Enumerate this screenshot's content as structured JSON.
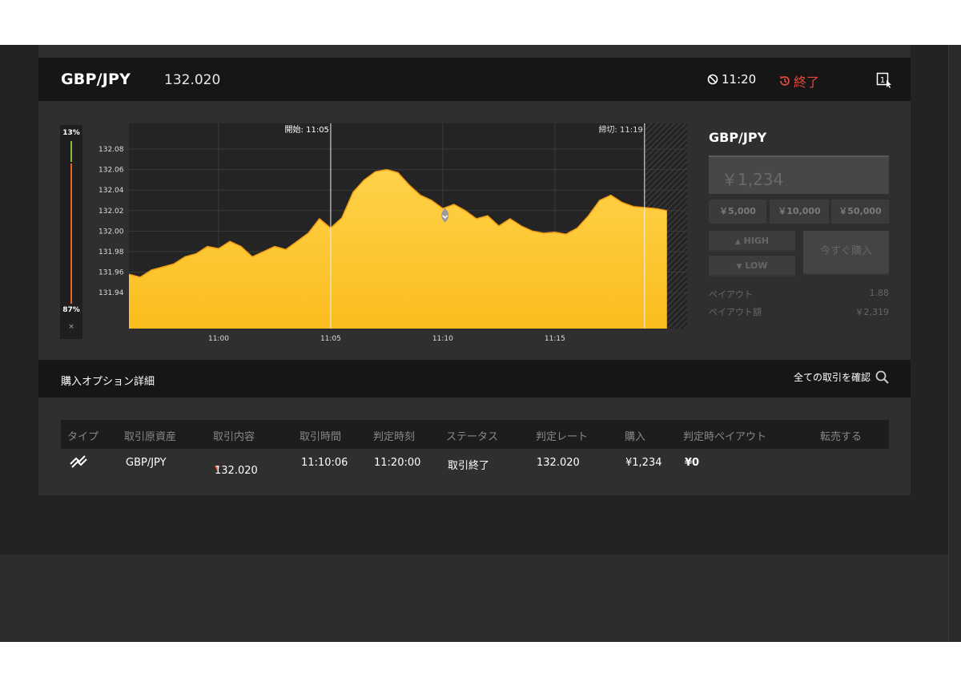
{
  "header": {
    "pair": "GBP/JPY",
    "price": "132.020",
    "timer": "11:20",
    "ended_label": "終了",
    "expand_label": "1"
  },
  "sentiment": {
    "top_pct": "13%",
    "bottom_pct": "87%",
    "close": "×"
  },
  "chart_data": {
    "type": "area",
    "y_ticks": [
      "132.08",
      "132.06",
      "132.04",
      "132.02",
      "132.00",
      "131.98",
      "131.96",
      "131.94"
    ],
    "x_ticks": [
      "11:00",
      "11:05",
      "11:10",
      "11:15"
    ],
    "ylim": [
      131.905,
      132.105
    ],
    "start_label": "開始: 11:05",
    "deadline_label": "締切: 11:19",
    "purchase": {
      "time": "11:10:06",
      "rate": 132.02
    },
    "series": [
      {
        "x": "10:56:00",
        "y": 131.958
      },
      {
        "x": "10:56:30",
        "y": 131.955
      },
      {
        "x": "10:57:00",
        "y": 131.962
      },
      {
        "x": "10:57:30",
        "y": 131.965
      },
      {
        "x": "10:58:00",
        "y": 131.968
      },
      {
        "x": "10:58:30",
        "y": 131.975
      },
      {
        "x": "10:59:00",
        "y": 131.978
      },
      {
        "x": "10:59:30",
        "y": 131.985
      },
      {
        "x": "11:00:00",
        "y": 131.983
      },
      {
        "x": "11:00:30",
        "y": 131.99
      },
      {
        "x": "11:01:00",
        "y": 131.985
      },
      {
        "x": "11:01:30",
        "y": 131.975
      },
      {
        "x": "11:02:00",
        "y": 131.98
      },
      {
        "x": "11:02:30",
        "y": 131.985
      },
      {
        "x": "11:03:00",
        "y": 131.982
      },
      {
        "x": "11:03:30",
        "y": 131.99
      },
      {
        "x": "11:04:00",
        "y": 131.998
      },
      {
        "x": "11:04:30",
        "y": 132.012
      },
      {
        "x": "11:05:00",
        "y": 132.003
      },
      {
        "x": "11:05:30",
        "y": 132.013
      },
      {
        "x": "11:06:00",
        "y": 132.038
      },
      {
        "x": "11:06:30",
        "y": 132.05
      },
      {
        "x": "11:07:00",
        "y": 132.058
      },
      {
        "x": "11:07:30",
        "y": 132.06
      },
      {
        "x": "11:08:00",
        "y": 132.057
      },
      {
        "x": "11:08:30",
        "y": 132.045
      },
      {
        "x": "11:09:00",
        "y": 132.035
      },
      {
        "x": "11:09:30",
        "y": 132.03
      },
      {
        "x": "11:10:00",
        "y": 132.022
      },
      {
        "x": "11:10:30",
        "y": 132.026
      },
      {
        "x": "11:11:00",
        "y": 132.02
      },
      {
        "x": "11:11:30",
        "y": 132.012
      },
      {
        "x": "11:12:00",
        "y": 132.015
      },
      {
        "x": "11:12:30",
        "y": 132.005
      },
      {
        "x": "11:13:00",
        "y": 132.012
      },
      {
        "x": "11:13:30",
        "y": 132.005
      },
      {
        "x": "11:14:00",
        "y": 132.0
      },
      {
        "x": "11:14:30",
        "y": 131.998
      },
      {
        "x": "11:15:00",
        "y": 131.999
      },
      {
        "x": "11:15:30",
        "y": 131.997
      },
      {
        "x": "11:16:00",
        "y": 132.003
      },
      {
        "x": "11:16:30",
        "y": 132.015
      },
      {
        "x": "11:17:00",
        "y": 132.03
      },
      {
        "x": "11:17:30",
        "y": 132.035
      },
      {
        "x": "11:18:00",
        "y": 132.028
      },
      {
        "x": "11:18:30",
        "y": 132.024
      },
      {
        "x": "11:19:00",
        "y": 132.023
      },
      {
        "x": "11:19:30",
        "y": 132.022
      },
      {
        "x": "11:20:00",
        "y": 132.02
      }
    ]
  },
  "side": {
    "title": "GBP/JPY",
    "amount": "￥1,234",
    "quick": [
      "￥5,000",
      "￥10,000",
      "￥50,000"
    ],
    "high": "HIGH",
    "low": "LOW",
    "buy_now": "今すぐ購入",
    "payout_label": "ペイアウト",
    "payout_value": "1.88",
    "payout_amount_label": "ペイアウト額",
    "payout_amount_value": "￥2,319"
  },
  "details": {
    "title": "購入オプション詳細",
    "view_all": "全ての取引を確認",
    "columns": [
      "タイプ",
      "取引原資産",
      "取引内容",
      "取引時間",
      "判定時刻",
      "ステータス",
      "判定レート",
      "購入",
      "判定時ペイアウト",
      "転売する"
    ],
    "row": {
      "asset": "GBP/JPY",
      "content": "132.020",
      "trade_time": "11:10:06",
      "judge_time": "11:20:00",
      "status": "取引終了",
      "judge_rate": "132.020",
      "purchase": "¥1,234",
      "payout": "¥0"
    }
  }
}
